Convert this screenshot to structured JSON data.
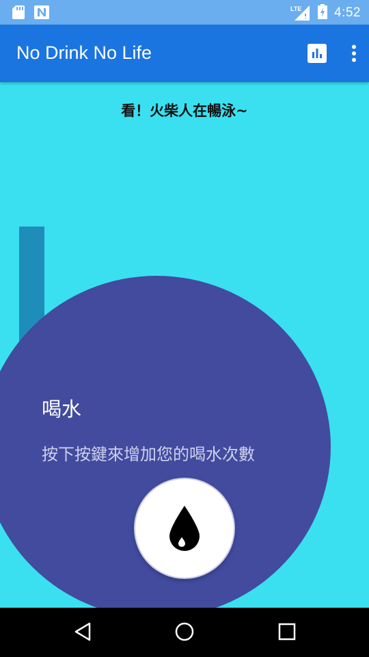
{
  "status_bar": {
    "network_label": "LTE",
    "time": "4:52",
    "icons": [
      "sd-card-icon",
      "n-notification-icon",
      "signal-icon",
      "battery-charging-icon"
    ]
  },
  "app_bar": {
    "title": "No Drink No Life",
    "actions": [
      "stats-icon",
      "overflow-menu-icon"
    ],
    "color": "#1a75e0"
  },
  "main": {
    "headline": "看！火柴人在暢泳~",
    "background_color": "#3ae0f0",
    "water_level_color": "#1f8db9"
  },
  "reveal": {
    "title": "喝水",
    "description": "按下按鍵來增加您的喝水次數",
    "circle_color": "#424b9e",
    "button_icon": "water-drop-icon"
  },
  "nav_bar": {
    "buttons": [
      "back-icon",
      "home-icon",
      "recents-icon"
    ]
  }
}
